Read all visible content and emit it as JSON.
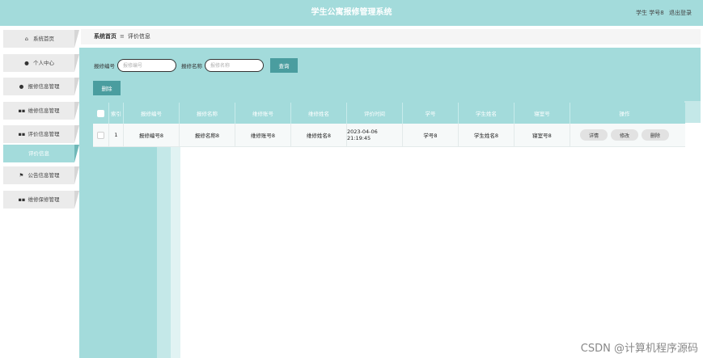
{
  "header": {
    "title": "学生公寓报修管理系统",
    "user_label": "学生 学号8",
    "logout": "退出登录"
  },
  "sidebar": {
    "items": [
      {
        "label": "系统首页",
        "icon": "home-icon",
        "glyph": "⌂"
      },
      {
        "label": "个人中心",
        "icon": "user-icon",
        "glyph": "●"
      },
      {
        "label": "报修信息管理",
        "icon": "user-icon",
        "glyph": "●"
      },
      {
        "label": "维修信息管理",
        "icon": "grid-icon",
        "glyph": "▪▪"
      },
      {
        "label": "评价信息管理",
        "icon": "grid-icon",
        "glyph": "▪▪"
      },
      {
        "label": "评价信息",
        "sub": true
      },
      {
        "label": "公告信息管理",
        "icon": "flag-icon",
        "glyph": "⚑"
      },
      {
        "label": "维修保修管理",
        "icon": "grid-icon",
        "glyph": "▪▪"
      }
    ]
  },
  "breadcrumb": {
    "home": "系统首页",
    "separator": "≡",
    "current": "评价信息"
  },
  "search": {
    "field1_label": "报修编号",
    "field1_placeholder": "报修编号",
    "field2_label": "报修名称",
    "field2_placeholder": "报修名称",
    "query_label": "查询"
  },
  "toolbar": {
    "delete_label": "删除"
  },
  "table": {
    "headers": [
      "索引",
      "报修编号",
      "报修名称",
      "维修账号",
      "维修姓名",
      "评价时间",
      "学号",
      "学生姓名",
      "寝室号",
      "操作"
    ],
    "rows": [
      {
        "index": "1",
        "repair_no": "报修编号8",
        "repair_name": "报修名称8",
        "worker_account": "维修账号8",
        "worker_name": "维修姓名8",
        "eval_time": "2023-04-06 21:19:45",
        "student_no": "学号8",
        "student_name": "学生姓名8",
        "dorm_no": "寝室号8",
        "actions": [
          "详情",
          "修改",
          "删除"
        ]
      }
    ]
  },
  "watermark": "CSDN @计算机程序源码",
  "colors": {
    "accent": "#a3dbdb",
    "button": "#4a9d9f"
  }
}
